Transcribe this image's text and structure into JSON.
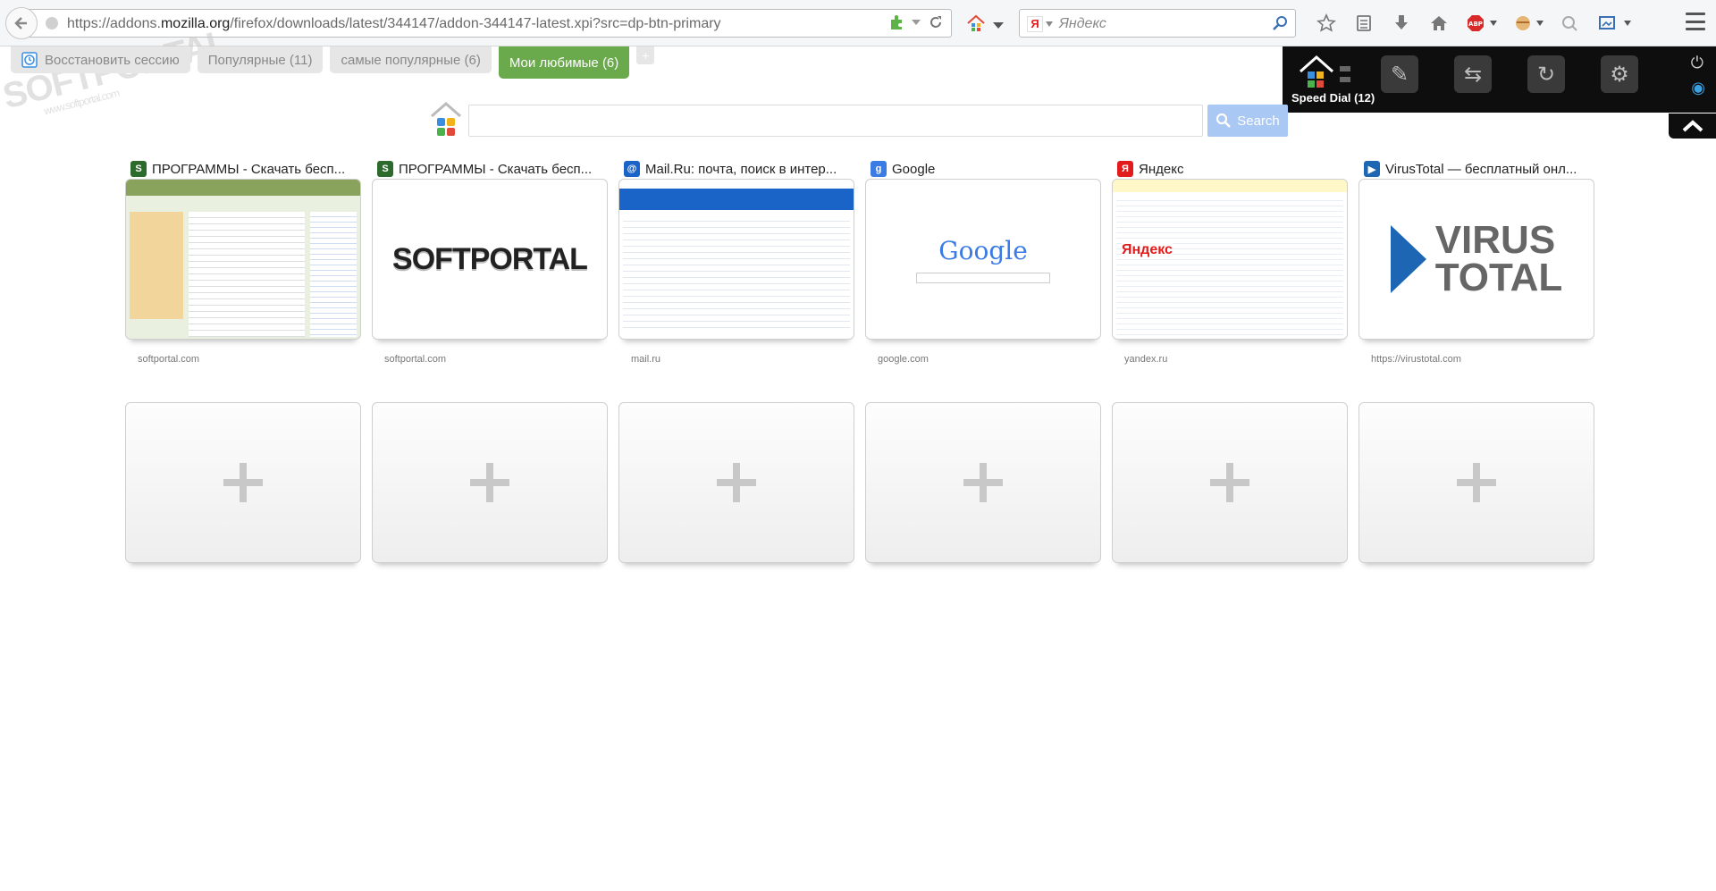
{
  "toolbar": {
    "url_prefix": "https://addons.",
    "url_domain": "mozilla.org",
    "url_path": "/firefox/downloads/latest/344147/addon-344147-latest.xpi?src=dp-btn-primary",
    "search_placeholder": "Яндекс",
    "search_engine_logo": "Я",
    "icons": [
      "star-icon",
      "bookmarks-list-icon",
      "download-icon",
      "home-icon",
      "adblock-icon",
      "extension-icon",
      "sync-icon",
      "screenshot-icon"
    ]
  },
  "group_tabs": [
    {
      "label": "Восстановить сессию",
      "active": false
    },
    {
      "label": "Популярные (11)",
      "active": false
    },
    {
      "label": "самые популярные (6)",
      "active": false
    },
    {
      "label": "Мои любимые (6)",
      "active": true
    }
  ],
  "add_tab_label": "+",
  "speed_dial": {
    "label": "Speed Dial (12)"
  },
  "search": {
    "button_label": "Search",
    "placeholder": ""
  },
  "tiles": [
    {
      "title": "ПРОГРАММЫ - Скачать бесп...",
      "url": "softportal.com",
      "fav_color": "#2d6b2d",
      "fav_text": "S",
      "thumb": "softportal-page"
    },
    {
      "title": "ПРОГРАММЫ - Скачать бесп...",
      "url": "softportal.com",
      "fav_color": "#2d6b2d",
      "fav_text": "S",
      "thumb": "softportal-logo",
      "thumb_text": "SOFTPORTAL"
    },
    {
      "title": "Mail.Ru: почта, поиск в интер...",
      "url": "mail.ru",
      "fav_color": "#1a63c7",
      "fav_text": "@",
      "thumb": "mail-page"
    },
    {
      "title": "Google",
      "url": "google.com",
      "fav_color": "#3b7ce4",
      "fav_text": "g",
      "thumb": "google-page",
      "thumb_text": "Google"
    },
    {
      "title": "Яндекс",
      "url": "yandex.ru",
      "fav_color": "#e21c1c",
      "fav_text": "Я",
      "thumb": "yandex-page",
      "thumb_text": "Яндекс"
    },
    {
      "title": "VirusTotal — бесплатный онл...",
      "url": "https://virustotal.com",
      "fav_color": "#1d66b3",
      "fav_text": "▶",
      "thumb": "virustotal-logo",
      "thumb_line1": "VIRUS",
      "thumb_line2": "TOTAL"
    }
  ],
  "empty_tiles_count": 6,
  "watermark": {
    "main": "SOFTPORTAL",
    "sub": "www.softportal.com"
  },
  "colors": {
    "active_tab": "#6aa94c",
    "search_button": "#a9c8f3",
    "panel": "#0e0e0e"
  }
}
